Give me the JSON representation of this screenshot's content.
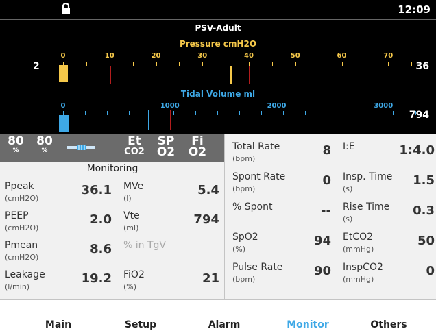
{
  "status": {
    "time": "12:09",
    "lock_icon": "lock-icon"
  },
  "mode": "PSV-Adult",
  "pressure_gauge": {
    "title": "Pressure cmH2O",
    "tick_labels": [
      "0",
      "10",
      "20",
      "30",
      "40",
      "50",
      "60",
      "70"
    ],
    "left_value": "2",
    "right_value": "36",
    "bar_value": 2,
    "marker_values": [
      10,
      36,
      40
    ],
    "color": "#f5c84a"
  },
  "volume_gauge": {
    "title": "Tidal Volume ml",
    "tick_labels": [
      "0",
      "1000",
      "2000",
      "3000"
    ],
    "right_value": "794",
    "bar_value": 80,
    "marker_values": [
      794,
      1000
    ],
    "color": "#3ea8e6"
  },
  "toolbar": {
    "o2_a": {
      "value": "80",
      "unit": "%"
    },
    "o2_b": {
      "value": "80",
      "unit": "%"
    },
    "flow_icon": "flow-sensor-icon",
    "etco2": {
      "top": "Et",
      "bottom": "CO2"
    },
    "spo2": {
      "top": "SP",
      "bottom": "O2"
    },
    "fio2": {
      "top": "Fi",
      "bottom": "O2"
    }
  },
  "monitoring_title": "Monitoring",
  "left_params": [
    {
      "name": "Ppeak",
      "unit": "(cmH2O)",
      "value": "36.1"
    },
    {
      "name": "PEEP",
      "unit": "(cmH2O)",
      "value": "2.0"
    },
    {
      "name": "Pmean",
      "unit": "(cmH2O)",
      "value": "8.6"
    },
    {
      "name": "Leakage",
      "unit": "(l/min)",
      "value": "19.2"
    }
  ],
  "mid_params": [
    {
      "name": "MVe",
      "unit": "(l)",
      "value": "5.4"
    },
    {
      "name": "Vte",
      "unit": "(ml)",
      "value": "794"
    },
    {
      "name": "% in TgV",
      "unit": "",
      "value": ""
    },
    {
      "name": "FiO2",
      "unit": "(%)",
      "value": "21"
    }
  ],
  "right_params": [
    {
      "name": "Total Rate",
      "unit": "(bpm)",
      "value": "8"
    },
    {
      "name": "Spont Rate",
      "unit": "(bpm)",
      "value": "0"
    },
    {
      "name": "% Spont",
      "unit": "",
      "value": "--"
    },
    {
      "name": "SpO2",
      "unit": "(%)",
      "value": "94"
    },
    {
      "name": "Pulse Rate",
      "unit": "(bpm)",
      "value": "90"
    }
  ],
  "far_params": [
    {
      "name": "I:E",
      "unit": "",
      "value": "1:4.0"
    },
    {
      "name": "Insp. Time",
      "unit": "(s)",
      "value": "1.5"
    },
    {
      "name": "Rise Time",
      "unit": "(s)",
      "value": "0.3"
    },
    {
      "name": "EtCO2",
      "unit": "(mmHg)",
      "value": "50"
    },
    {
      "name": "InspCO2",
      "unit": "(mmHg)",
      "value": "0"
    }
  ],
  "nav": [
    {
      "label": "Main",
      "active": false
    },
    {
      "label": "Setup",
      "active": false
    },
    {
      "label": "Alarm",
      "active": false
    },
    {
      "label": "Monitor",
      "active": true
    },
    {
      "label": "Others",
      "active": false
    }
  ]
}
